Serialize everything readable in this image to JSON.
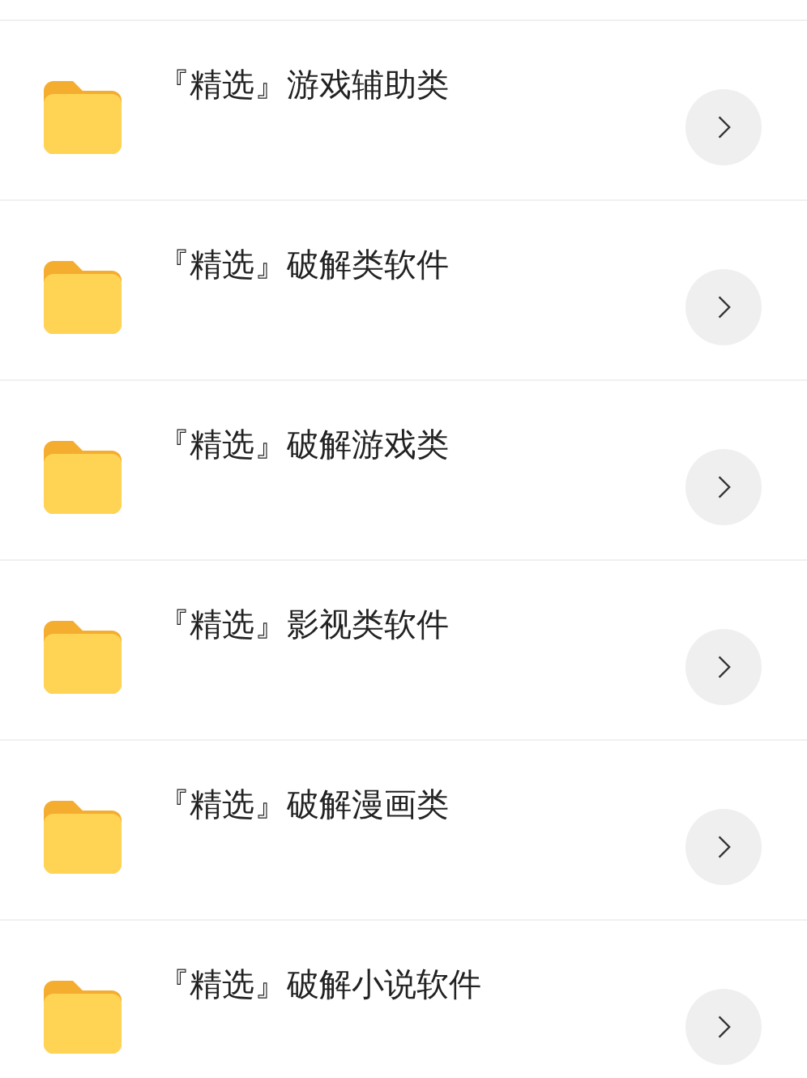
{
  "folders": [
    {
      "name": "『精选』游戏辅助类"
    },
    {
      "name": "『精选』破解类软件"
    },
    {
      "name": "『精选』破解游戏类"
    },
    {
      "name": "『精选』影视类软件"
    },
    {
      "name": "『精选』破解漫画类"
    },
    {
      "name": "『精选』破解小说软件"
    }
  ]
}
